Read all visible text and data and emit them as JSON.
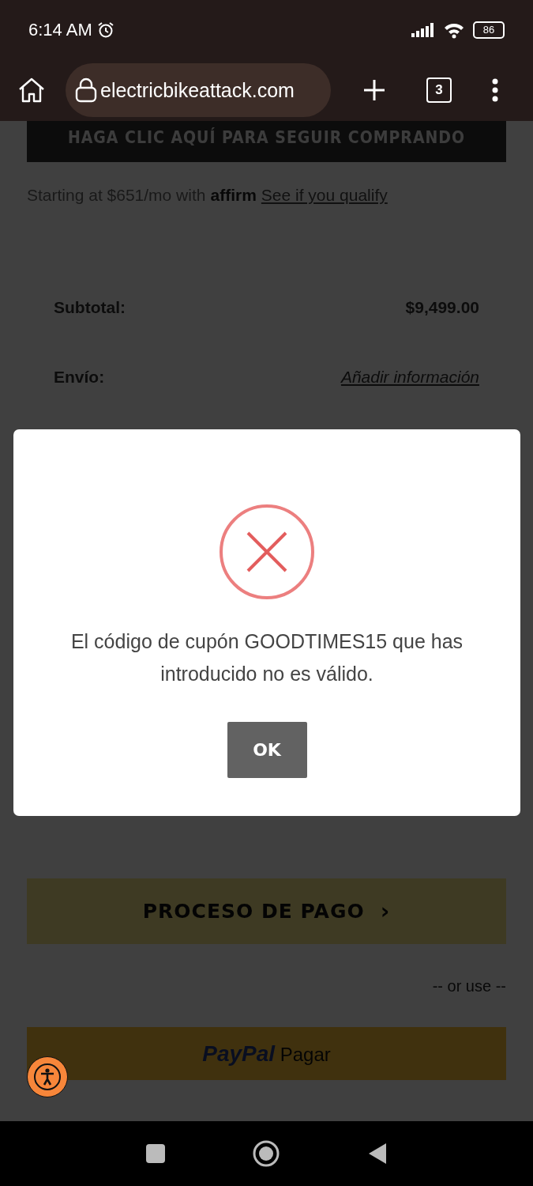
{
  "status_bar": {
    "time": "6:14 AM",
    "battery": "86"
  },
  "browser": {
    "url": "electricbikeattack.com",
    "tab_count": "3"
  },
  "page": {
    "continue_button": "HAGA CLIC AQUÍ PARA SEGUIR COMPRANDO",
    "financing": {
      "text": "Starting at $651/mo with",
      "brand": "affirm",
      "link": "See if you qualify"
    },
    "summary": [
      {
        "label": "Subtotal:",
        "value": "$9,499.00",
        "kind": "amount"
      },
      {
        "label": "Envío:",
        "value": "Añadir información",
        "kind": "link"
      }
    ],
    "checkout_button": "PROCESO DE PAGO",
    "checkout_arrow": "›",
    "alt_label": "-- or use --",
    "paypal": {
      "brand": "PayPal",
      "label": "Pagar"
    }
  },
  "dialog": {
    "message": "El código de cupón GOODTIMES15 que has introducido no es válido.",
    "button": "OK"
  }
}
